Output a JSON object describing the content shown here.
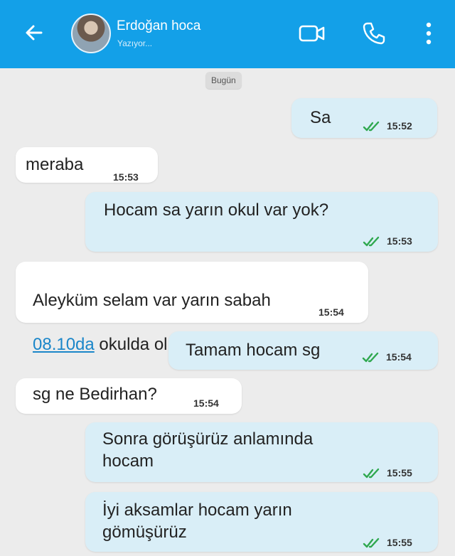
{
  "header": {
    "contact_name": "Erdoğan hoca",
    "status": "Yazıyor...",
    "icons": [
      "back-arrow-icon",
      "video-call-icon",
      "phone-icon",
      "more-vert-icon"
    ],
    "bar_color": "#13a0e8"
  },
  "date_chip": "Bugün",
  "messages": [
    {
      "direction": "out",
      "text": "Sa",
      "time": "15:52",
      "read": true
    },
    {
      "direction": "in",
      "text": "meraba",
      "time": "15:53"
    },
    {
      "direction": "out",
      "text": "Hocam sa yarın okul var yok?",
      "time": "15:53",
      "read": true
    },
    {
      "direction": "in",
      "link_text": "08.10da",
      "text_line1": "Aleyküm selam var yarın sabah",
      "text_line2_rest": " okulda olun",
      "time": "15:54"
    },
    {
      "direction": "out",
      "text": "Tamam hocam sg",
      "time": "15:54",
      "read": true
    },
    {
      "direction": "in",
      "text": "sg ne Bedirhan?",
      "time": "15:54"
    },
    {
      "direction": "out",
      "text": "Sonra görüşürüz anlamında\nhocam",
      "time": "15:55",
      "read": true
    },
    {
      "direction": "out",
      "text": "İyi aksamlar hocam yarın\ngömüşürüz",
      "time": "15:55",
      "read": true
    }
  ],
  "colors": {
    "outgoing_bubble": "#d9eef7",
    "incoming_bubble": "#ffffff",
    "read_tick": "#2fa84f",
    "background": "#ececec"
  }
}
